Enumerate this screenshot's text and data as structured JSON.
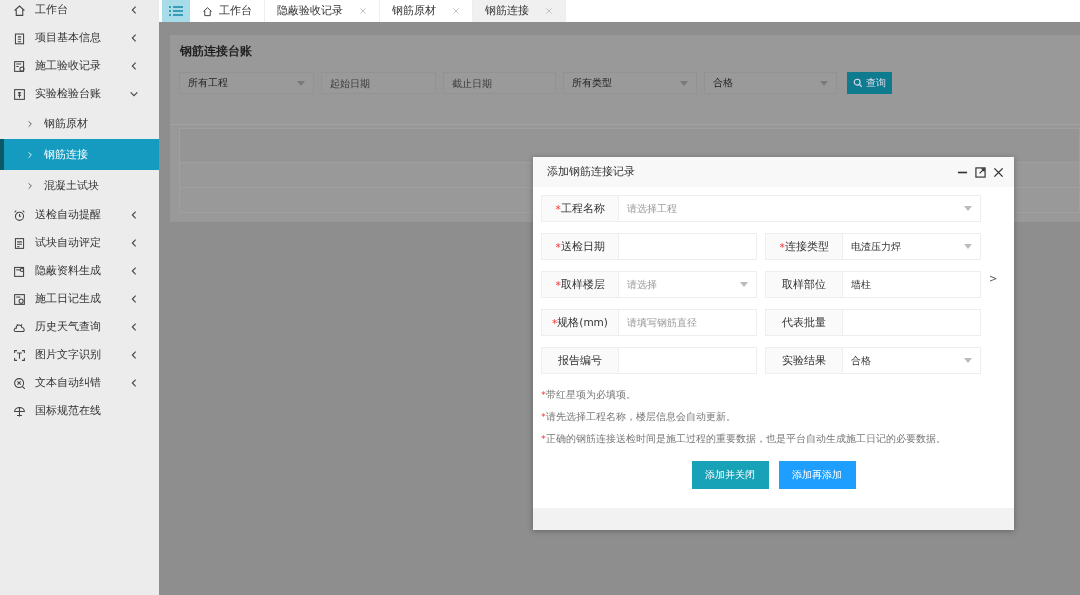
{
  "sidebar": {
    "items": [
      {
        "label": "工作台",
        "kind": "group",
        "expanded": false
      },
      {
        "label": "项目基本信息",
        "kind": "group",
        "expanded": false
      },
      {
        "label": "施工验收记录",
        "kind": "group",
        "expanded": false
      },
      {
        "label": "实验检验台账",
        "kind": "group",
        "expanded": true,
        "children": [
          {
            "label": "钢筋原材",
            "selected": false
          },
          {
            "label": "钢筋连接",
            "selected": true
          },
          {
            "label": "混凝土试块",
            "selected": false
          }
        ]
      },
      {
        "label": "送检自动提醒",
        "kind": "group",
        "expanded": false
      },
      {
        "label": "试块自动评定",
        "kind": "group",
        "expanded": false
      },
      {
        "label": "隐蔽资料生成",
        "kind": "group",
        "expanded": false
      },
      {
        "label": "施工日记生成",
        "kind": "group",
        "expanded": false
      },
      {
        "label": "历史天气查询",
        "kind": "group",
        "expanded": false
      },
      {
        "label": "图片文字识别",
        "kind": "group",
        "expanded": false
      },
      {
        "label": "文本自动纠错",
        "kind": "group",
        "expanded": false
      },
      {
        "label": "国标规范在线",
        "kind": "link"
      }
    ]
  },
  "tabs": [
    {
      "label": "工作台",
      "kind": "home",
      "selected": false
    },
    {
      "label": "隐蔽验收记录",
      "kind": "closable",
      "selected": false
    },
    {
      "label": "钢筋原材",
      "kind": "closable",
      "selected": false
    },
    {
      "label": "钢筋连接",
      "kind": "closable",
      "selected": true
    }
  ],
  "ledger": {
    "title": "钢筋连接台账",
    "filters": [
      {
        "kind": "select",
        "value": "所有工程"
      },
      {
        "kind": "date",
        "placeholder": "起始日期"
      },
      {
        "kind": "date",
        "placeholder": "截止日期"
      },
      {
        "kind": "select",
        "value": "所有类型"
      },
      {
        "kind": "select",
        "value": "合格"
      }
    ],
    "search_button": "查询"
  },
  "dialog": {
    "title": "添加钢筋连接记录",
    "fields": [
      {
        "mark": "*",
        "label": "工程名称",
        "kind": "select",
        "placeholder": "请选择工程",
        "wide": true
      },
      {
        "mark": "*",
        "label": "送检日期",
        "kind": "text"
      },
      {
        "mark": "*",
        "label": "连接类型",
        "kind": "select",
        "value": "电渣压力焊"
      },
      {
        "mark": "*",
        "label": "取样楼层",
        "kind": "select",
        "placeholder": "请选择"
      },
      {
        "label": "取样部位",
        "kind": "text",
        "value": "墙柱"
      },
      {
        "mark": "*",
        "label": "规格(mm)",
        "kind": "text",
        "placeholder": "请填写钢筋直径"
      },
      {
        "label": "代表批量",
        "kind": "text"
      },
      {
        "label": "报告编号",
        "kind": "text"
      },
      {
        "label": "实验结果",
        "kind": "select",
        "value": "合格"
      }
    ],
    "side_arrow": ">",
    "notes": [
      {
        "mark": "*",
        "text": "带红星项为必填项。"
      },
      {
        "mark": "*",
        "text": "请先选择工程名称，楼层信息会自动更新。"
      },
      {
        "mark": "*",
        "text": "正确的钢筋连接送检时间是施工过程的重要数据，也是平台自动生成施工日记的必要数据。"
      }
    ],
    "buttons": [
      {
        "label": "添加并关闭",
        "kind": "primary"
      },
      {
        "label": "添加再添加",
        "kind": "secondary"
      }
    ]
  }
}
